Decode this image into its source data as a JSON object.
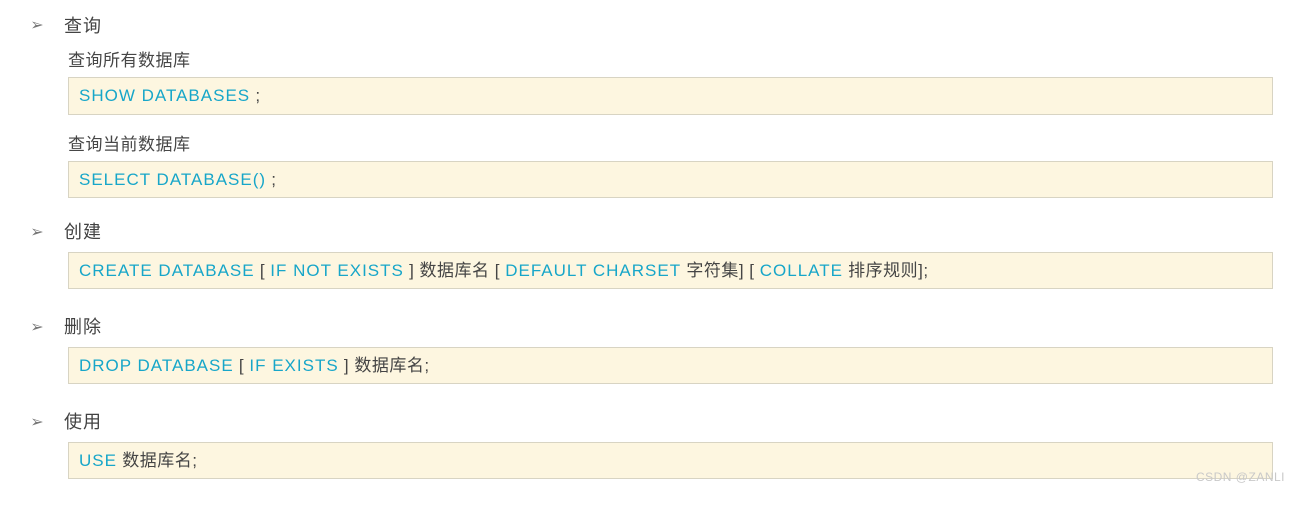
{
  "sections": {
    "query": {
      "title": "查询",
      "sub1_label": "查询所有数据库",
      "sub1_code": {
        "kw": "SHOW DATABASES",
        "tail": " ;"
      },
      "sub2_label": "查询当前数据库",
      "sub2_code": {
        "kw": "SELECT DATABASE()",
        "tail": " ;"
      }
    },
    "create": {
      "title": "创建",
      "code": {
        "p1": "CREATE DATABASE",
        "t1": " [ ",
        "p2": "IF NOT EXISTS",
        "t2": " ] 数据库名 [ ",
        "p3": "DEFAULT CHARSET",
        "t3": " 字符集] [ ",
        "p4": "COLLATE",
        "t4": "  排序规则];"
      }
    },
    "drop": {
      "title": "删除",
      "code": {
        "p1": "DROP DATABASE",
        "t1": " [ ",
        "p2": "IF EXISTS",
        "t2": " ] 数据库名;"
      }
    },
    "use": {
      "title": "使用",
      "code": {
        "p1": "USE",
        "t1": "  数据库名;"
      }
    }
  },
  "watermark": "CSDN @ZANLI",
  "bullet": "➢"
}
